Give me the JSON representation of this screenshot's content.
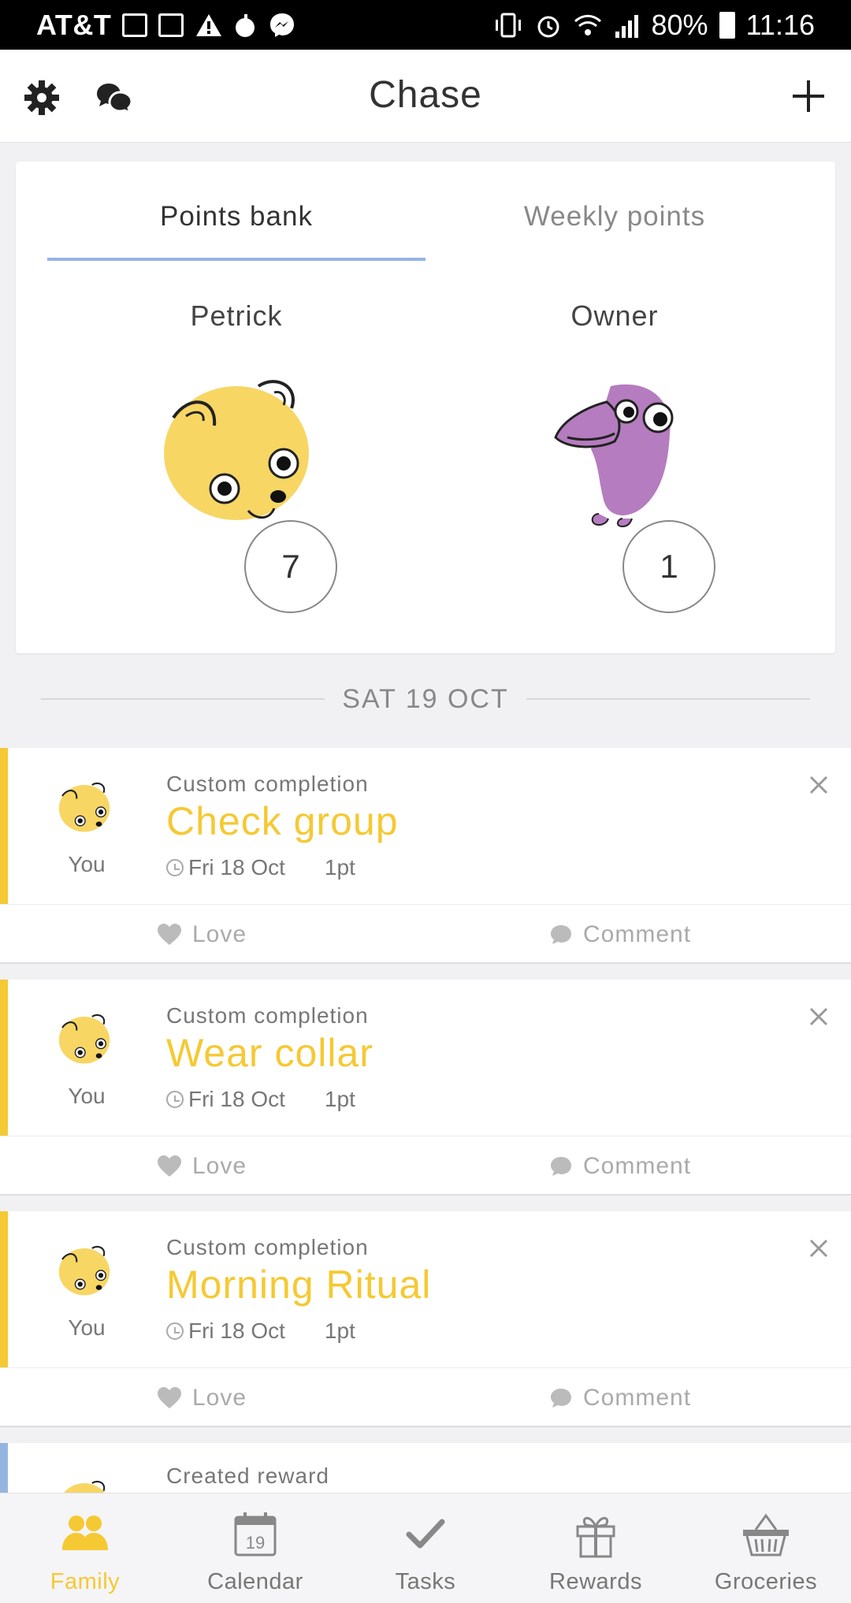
{
  "status_bar": {
    "carrier": "AT&T",
    "battery": "80%",
    "time": "11:16"
  },
  "header": {
    "title": "Chase"
  },
  "points_card": {
    "tabs": [
      {
        "label": "Points bank",
        "active": true
      },
      {
        "label": "Weekly points",
        "active": false
      }
    ],
    "members": [
      {
        "name": "Petrick",
        "avatar": "yellow-dog-avatar",
        "points": "7"
      },
      {
        "name": "Owner",
        "avatar": "purple-bird-avatar",
        "points": "1"
      }
    ]
  },
  "date_divider": "SAT 19 OCT",
  "activities": [
    {
      "type": "Custom completion",
      "title": "Check group",
      "user": "You",
      "date": "Fri 18 Oct",
      "points": "1pt",
      "love": "Love",
      "comment": "Comment"
    },
    {
      "type": "Custom completion",
      "title": "Wear collar",
      "user": "You",
      "date": "Fri 18 Oct",
      "points": "1pt",
      "love": "Love",
      "comment": "Comment"
    },
    {
      "type": "Custom completion",
      "title": "Morning Ritual",
      "user": "You",
      "date": "Fri 18 Oct",
      "points": "1pt",
      "love": "Love",
      "comment": "Comment"
    },
    {
      "type": "Created reward"
    }
  ],
  "bottom_nav": [
    {
      "label": "Family",
      "icon": "family-icon",
      "active": true
    },
    {
      "label": "Calendar",
      "icon": "calendar-icon",
      "day": "19"
    },
    {
      "label": "Tasks",
      "icon": "check-icon"
    },
    {
      "label": "Rewards",
      "icon": "gift-icon"
    },
    {
      "label": "Groceries",
      "icon": "basket-icon"
    }
  ],
  "colors": {
    "accent_yellow": "#f5c933",
    "tab_blue": "#95b5e1",
    "bird_purple": "#b57cbf"
  }
}
